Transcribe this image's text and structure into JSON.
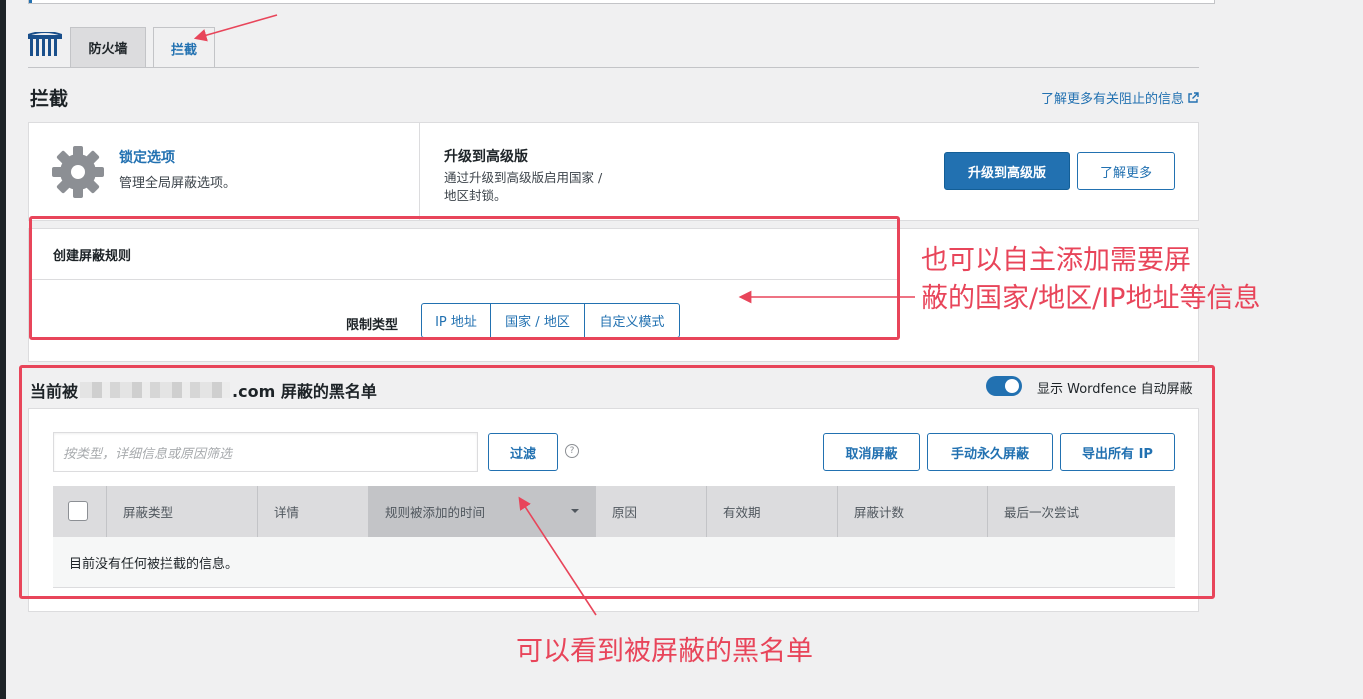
{
  "tabs": {
    "firewall": "防火墙",
    "blocking": "拦截"
  },
  "page": {
    "title": "拦截",
    "learn_more_link": "了解更多有关阻止的信息"
  },
  "options": {
    "title": "锁定选项",
    "description": "管理全局屏蔽选项。",
    "upgrade_title": "升级到高级版",
    "upgrade_desc_1": "通过升级到高级版启用国家 /",
    "upgrade_desc_2": "地区封锁。",
    "upgrade_button": "升级到高级版",
    "learn_more_button": "了解更多"
  },
  "create_rule": {
    "title": "创建屏蔽规则",
    "limit_label": "限制类型",
    "types": [
      "IP 地址",
      "国家 / 地区",
      "自定义模式"
    ]
  },
  "blacklist": {
    "title_prefix": "当前被",
    "title_suffix": ".com 屏蔽的黑名单",
    "toggle_label": "显示 Wordfence 自动屏蔽",
    "filter_placeholder": "按类型，详细信息或原因筛选",
    "filter_button": "过滤",
    "help": "?",
    "unblock_button": "取消屏蔽",
    "perm_block_button": "手动永久屏蔽",
    "export_button": "导出所有 IP",
    "columns": [
      "屏蔽类型",
      "详情",
      "规则被添加的时间",
      "原因",
      "有效期",
      "屏蔽计数",
      "最后一次尝试"
    ],
    "empty_message": "目前没有任何被拦截的信息。"
  },
  "annotations": {
    "note1_line1": "也可以自主添加需要屏",
    "note1_line2": "蔽的国家/地区/IP地址等信息",
    "note2": "可以看到被屏蔽的黑名单"
  },
  "colors": {
    "accent": "#2271b1",
    "annotation": "#e8455a"
  }
}
